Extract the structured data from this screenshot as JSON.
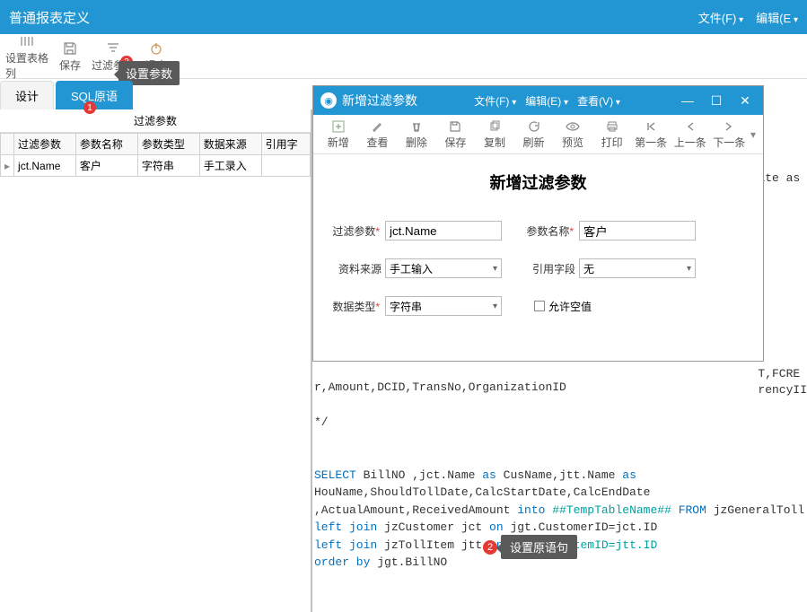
{
  "titlebar": {
    "title": "普通报表定义",
    "menus": {
      "file": "文件(F)",
      "edit": "编辑(E"
    }
  },
  "toolbar": {
    "setcol": "设置表格列",
    "save": "保存",
    "filter": "过滤参数",
    "exit": "退出",
    "badge3": "3",
    "tooltip": "设置参数"
  },
  "tabs": {
    "design": "设计",
    "sql": "SQL原语",
    "badge1": "1"
  },
  "leftpane": {
    "title": "过滤参数",
    "cols": {
      "c0": "过滤参数",
      "c1": "参数名称",
      "c2": "参数类型",
      "c3": "数据来源",
      "c4": "引用字"
    },
    "row": {
      "mark": "▸",
      "c0": "jct.Name",
      "c1": "客户",
      "c2": "字符串",
      "c3": "手工录入",
      "c4": ""
    }
  },
  "dialog": {
    "title": "新增过滤参数",
    "menus": {
      "file": "文件(F)",
      "edit": "编辑(E)",
      "view": "查看(V)"
    },
    "tb": {
      "new": "新增",
      "view": "查看",
      "del": "删除",
      "save": "保存",
      "copy": "复制",
      "refresh": "刷新",
      "preview": "预览",
      "print": "打印",
      "first": "第一条",
      "prev": "上一条",
      "next": "下一条"
    },
    "heading": "新增过滤参数",
    "f": {
      "filter_lbl": "过滤参数",
      "filter_val": "jct.Name",
      "name_lbl": "参数名称",
      "name_val": "客户",
      "src_lbl": "资料来源",
      "src_val": "手工输入",
      "ref_lbl": "引用字段",
      "ref_val": "无",
      "type_lbl": "数据类型",
      "type_val": "字符串",
      "null_lbl": "允许空值"
    }
  },
  "codefloat": {
    "l1": "ate as",
    "l2": "T,FCRE",
    "l3": "rencyII"
  },
  "code": {
    "l1": "r,Amount,DCID,TransNo,OrganizationID",
    "l2": "*/",
    "sel": "SELECT",
    "billno": " BillNO ,jct.Name ",
    "as": "as",
    "cus": " CusName,jtt.Name ",
    "l4": "HouName,ShouldTollDate,CalcStartDate,CalcEndDate",
    "l5a": ",ActualAmount,ReceivedAmount ",
    "into": "into ",
    "ttp": "##TempTableName##",
    "from": " FROM ",
    "t5": "jzGeneralToll jgt",
    "lj": "left join ",
    "cust": "jzCustomer jct ",
    "on": "on ",
    "cond1": "jgt.CustomerID=jct.ID",
    "toll": "jzTollItem jtt ",
    "cond2": "jgt.TollItemID=jtt.ID",
    "ord": "order by ",
    "ordv": "jgt.BillNO"
  },
  "callout2": {
    "num": "2",
    "text": "设置原语句"
  }
}
